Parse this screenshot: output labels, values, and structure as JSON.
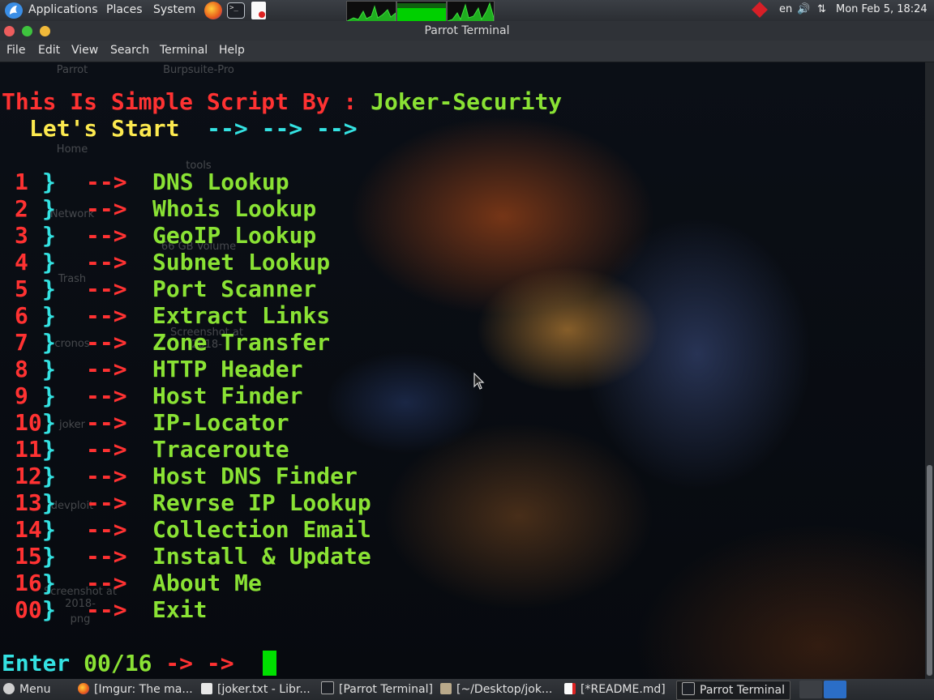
{
  "top_panel": {
    "menus": [
      "Applications",
      "Places",
      "System"
    ],
    "keyboard_layout": "en",
    "clock": "Mon Feb  5, 18:24"
  },
  "window": {
    "title": "Parrot Terminal",
    "menu": [
      "File",
      "Edit",
      "View",
      "Search",
      "Terminal",
      "Help"
    ]
  },
  "desktop_icons": [
    "Parrot",
    "Burpsuite-Pro",
    "Home",
    "tools",
    "Network",
    "66 GB Volume",
    "Trash",
    "cronos",
    "Screenshot at 2018-",
    "joker",
    "devploit",
    "Screenshot at 2018-",
    "png"
  ],
  "terminal": {
    "banner_left": "This Is Simple Script By : ",
    "banner_author": "Joker-Security",
    "start_text": "Let's Start",
    "start_arrows": "--> --> -->",
    "menu_items": [
      {
        "num": "1",
        "brace": "}",
        "arrow": "-->",
        "label": "DNS Lookup"
      },
      {
        "num": "2",
        "brace": "}",
        "arrow": "-->",
        "label": "Whois Lookup"
      },
      {
        "num": "3",
        "brace": "}",
        "arrow": "-->",
        "label": "GeoIP Lookup"
      },
      {
        "num": "4",
        "brace": "}",
        "arrow": "-->",
        "label": "Subnet Lookup"
      },
      {
        "num": "5",
        "brace": "}",
        "arrow": "-->",
        "label": "Port Scanner"
      },
      {
        "num": "6",
        "brace": "}",
        "arrow": "-->",
        "label": "Extract Links"
      },
      {
        "num": "7",
        "brace": "}",
        "arrow": "-->",
        "label": "Zone Transfer"
      },
      {
        "num": "8",
        "brace": "}",
        "arrow": "-->",
        "label": "HTTP Header"
      },
      {
        "num": "9",
        "brace": "}",
        "arrow": "-->",
        "label": "Host Finder"
      },
      {
        "num": "10",
        "brace": "}",
        "arrow": "-->",
        "label": "IP-Locator"
      },
      {
        "num": "11",
        "brace": "}",
        "arrow": "-->",
        "label": "Traceroute"
      },
      {
        "num": "12",
        "brace": "}",
        "arrow": "-->",
        "label": "Host DNS Finder"
      },
      {
        "num": "13",
        "brace": "}",
        "arrow": "-->",
        "label": "Revrse IP Lookup"
      },
      {
        "num": "14",
        "brace": "}",
        "arrow": "-->",
        "label": "Collection Email"
      },
      {
        "num": "15",
        "brace": "}",
        "arrow": "-->",
        "label": "Install & Update"
      },
      {
        "num": "16",
        "brace": "}",
        "arrow": "-->",
        "label": "About Me"
      },
      {
        "num": "00",
        "brace": "}",
        "arrow": "-->",
        "label": "Exit"
      }
    ],
    "prompt_label": "Enter ",
    "prompt_range": "00/16",
    "prompt_arrows": " -> -> "
  },
  "taskbar": {
    "menu_label": "Menu",
    "tasks": [
      "[Imgur: The ma...",
      "[joker.txt - Libr...",
      "[Parrot Terminal]",
      "[~/Desktop/jok...",
      "[*README.md]",
      "Parrot Terminal"
    ]
  },
  "colors": {
    "number": "#ff3232",
    "brace": "#34e2e2",
    "arrow": "#ff3232",
    "label": "#8ae234",
    "banner_author": "#fce94f",
    "cursor": "#00e000"
  },
  "icons": {
    "logo": "parrot-logo-icon",
    "firefox": "firefox-icon",
    "terminal": "terminal-icon",
    "editor": "text-editor-icon",
    "network": "network-icon",
    "volume": "volume-icon",
    "transfer": "network-transfer-icon",
    "menu": "footprint-menu-icon"
  }
}
